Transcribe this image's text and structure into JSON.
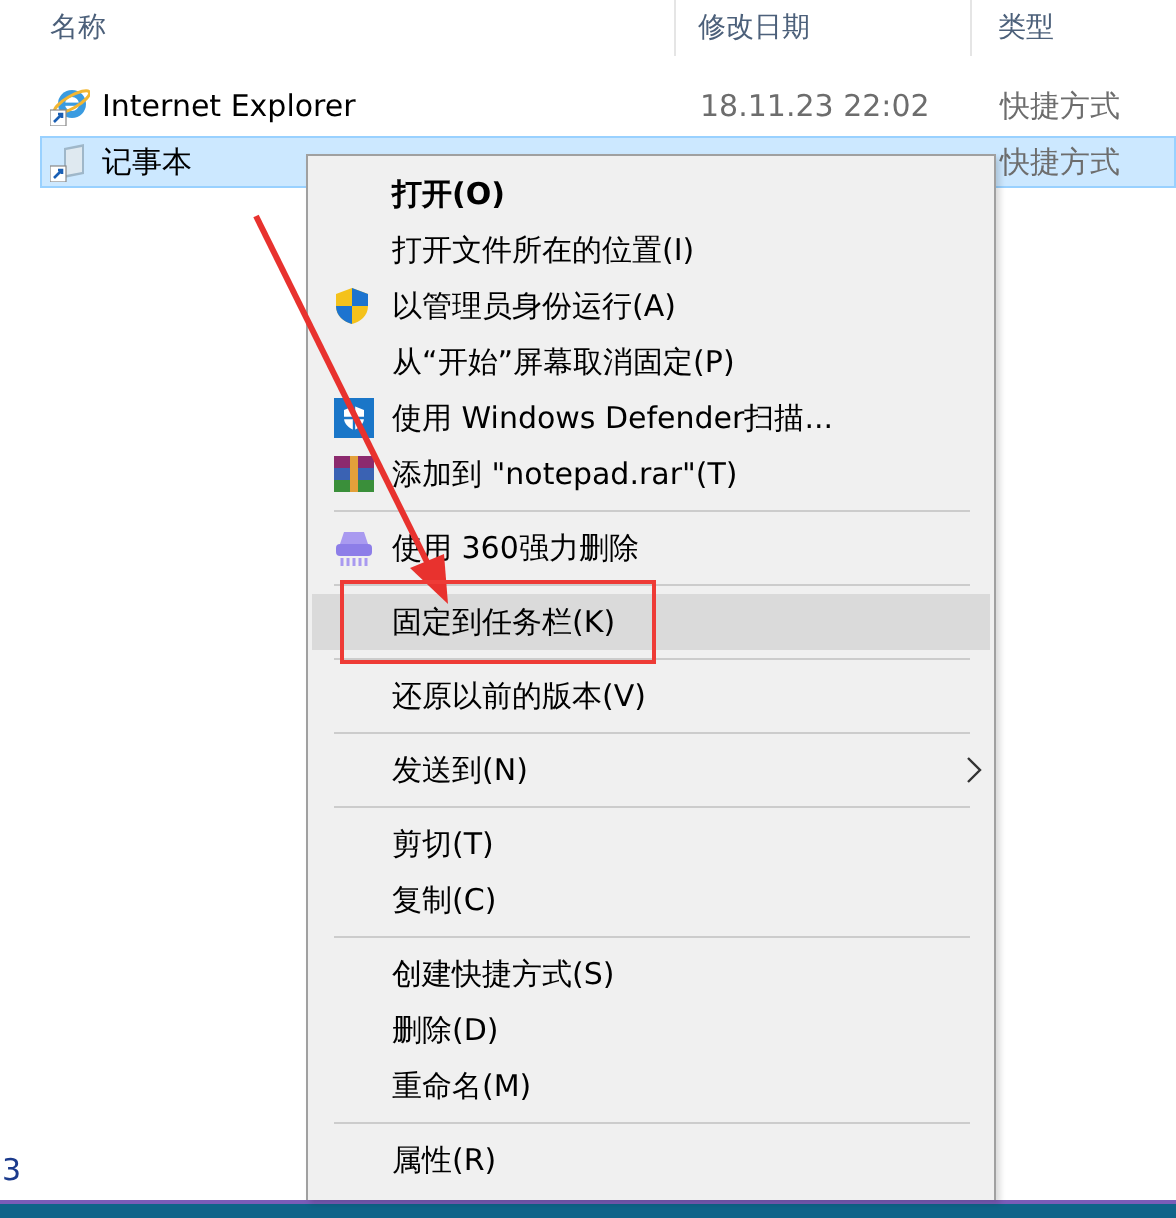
{
  "file_list": {
    "columns": [
      {
        "label": "名称"
      },
      {
        "label": "修改日期"
      },
      {
        "label": "类型"
      }
    ],
    "rows": [
      {
        "kind": "browser",
        "name": "Internet Explorer",
        "modified": "18.11.23 22:02",
        "type": "快捷方式",
        "selected": false
      },
      {
        "kind": "notepad",
        "name": "记事本",
        "type": "快捷方式",
        "selected": true
      }
    ]
  },
  "status_bar": {
    "text": "3"
  },
  "context_menu": {
    "groups": [
      [
        {
          "kind": "default",
          "label": "打开(O)",
          "selected": false
        },
        {
          "kind": "command",
          "label": "打开文件所在的位置(I)",
          "selected": false
        },
        {
          "kind": "command",
          "label": "以管理员身份运行(A)",
          "selected": false
        },
        {
          "kind": "command",
          "label": "从“开始”屏幕取消固定(P)",
          "selected": false
        },
        {
          "kind": "command",
          "label": "使用 Windows Defender扫描...",
          "selected": false
        },
        {
          "kind": "command",
          "label": "添加到 \"notepad.rar\"(T)",
          "selected": false
        }
      ],
      [
        {
          "kind": "command",
          "label": "使用 360强力删除",
          "selected": false
        }
      ],
      [
        {
          "kind": "command",
          "label": "固定到任务栏(K)",
          "selected": true
        }
      ],
      [
        {
          "kind": "command",
          "label": "还原以前的版本(V)",
          "selected": false
        }
      ],
      [
        {
          "kind": "submenu",
          "label": "发送到(N)",
          "selected": false
        }
      ],
      [
        {
          "kind": "command",
          "label": "剪切(T)",
          "selected": false
        },
        {
          "kind": "command",
          "label": "复制(C)",
          "selected": false
        }
      ],
      [
        {
          "kind": "command",
          "label": "创建快捷方式(S)",
          "selected": false
        },
        {
          "kind": "command",
          "label": "删除(D)",
          "selected": false
        },
        {
          "kind": "command",
          "label": "重命名(M)",
          "selected": false
        }
      ],
      [
        {
          "kind": "command",
          "label": "属性(R)",
          "selected": false
        }
      ]
    ]
  }
}
